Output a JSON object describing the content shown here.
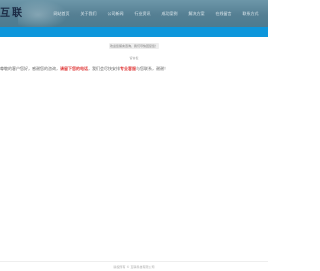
{
  "header": {
    "logo_text": "互联",
    "nav": [
      "网站首页",
      "关于我们",
      "公司新闻",
      "行业资讯",
      "成功案例",
      "解决方案",
      "在线留言",
      "联系方式"
    ]
  },
  "main": {
    "notice_pill": "欢迎您留言咨询，我们尽快回复您！",
    "small_label": "留言板",
    "message_prefix": "尊敬的客户您好，感谢您的咨询，",
    "message_red_1": "请留下您的电话",
    "message_middle": "，我们会尽快安排",
    "message_red_2": "专业客服",
    "message_suffix": "与您联系，谢谢！"
  },
  "footer": {
    "text": "版权所有 © 互联科技有限公司"
  },
  "colors": {
    "header": "#557f93",
    "band": "#0d96db",
    "accent_red": "#e03b3b"
  }
}
